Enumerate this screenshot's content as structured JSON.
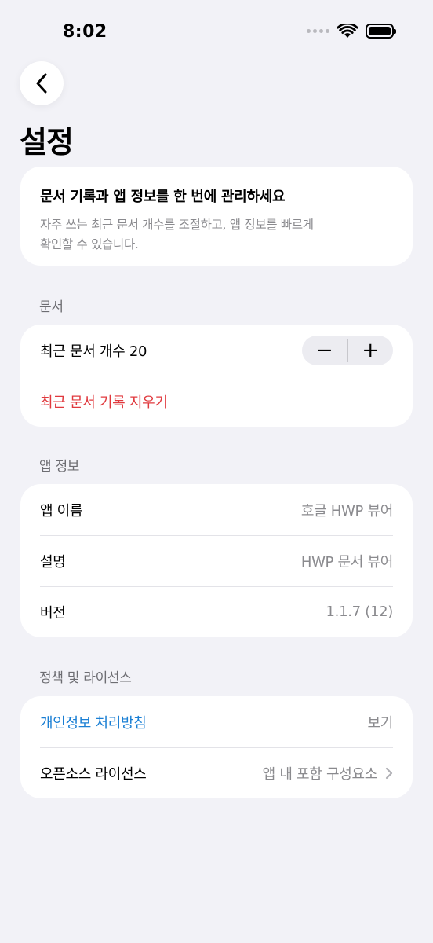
{
  "status_bar": {
    "time": "8:02"
  },
  "page": {
    "title": "설정"
  },
  "intro": {
    "title": "문서 기록과 앱 정보를 한 번에 관리하세요",
    "description_line1": "자주 쓰는 최근 문서 개수를 조절하고, 앱 정보를 빠르게",
    "description_line2": "확인할 수 있습니다."
  },
  "documents": {
    "header": "문서",
    "recent_count_label": "최근 문서 개수 20",
    "decrement": "−",
    "increment": "+",
    "clear_history": "최근 문서 기록 지우기"
  },
  "app_info": {
    "header": "앱 정보",
    "rows": [
      {
        "label": "앱 이름",
        "value": "호글 HWP 뷰어"
      },
      {
        "label": "설명",
        "value": "HWP 문서 뷰어"
      },
      {
        "label": "버전",
        "value": "1.1.7 (12)"
      }
    ]
  },
  "policy": {
    "header": "정책 및 라이선스",
    "privacy_label": "개인정보 처리방침",
    "privacy_value": "보기",
    "oss_label": "오픈소스 라이선스",
    "oss_value": "앱 내 포함 구성요소"
  },
  "colors": {
    "background": "#f2f2f7",
    "danger": "#e0393e",
    "link": "#1a7fd4",
    "secondary_text": "#8a8a8e"
  }
}
